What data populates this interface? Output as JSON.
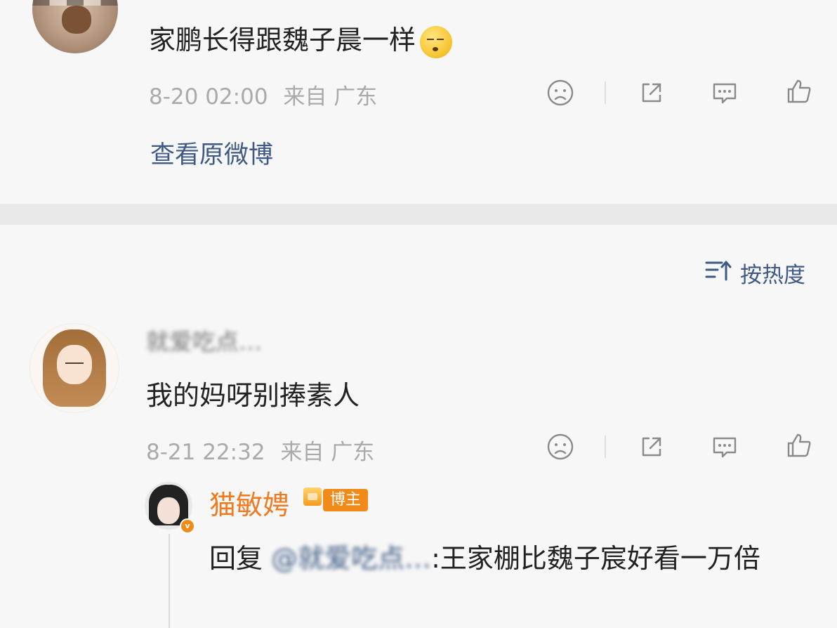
{
  "post1": {
    "comment": "家鹏长得跟魏子晨一样",
    "time": "8-20 02:00",
    "from": "来自 广东",
    "view_original": "查看原微博"
  },
  "sort": {
    "label": "按热度",
    "icon": "sort-icon"
  },
  "post2": {
    "username": "就爱吃点…",
    "comment": "我的妈呀别捧素人",
    "time": "8-21 22:32",
    "from": "来自 广东"
  },
  "reply": {
    "username": "猫敏娉",
    "tag": "博主",
    "verify": "v",
    "reply_prefix": "回复",
    "mention": "@就爱吃点…",
    "reply_text": ":王家棚比魏子宸好看一万倍"
  },
  "icons": [
    "dislike-icon",
    "share-icon",
    "comment-icon",
    "like-icon"
  ],
  "colors": {
    "link": "#3e5a84",
    "name_vip": "#f07a1f",
    "meta": "#aaaaaa",
    "bg": "#f7f7f7",
    "separator": "#e9e9e9"
  }
}
